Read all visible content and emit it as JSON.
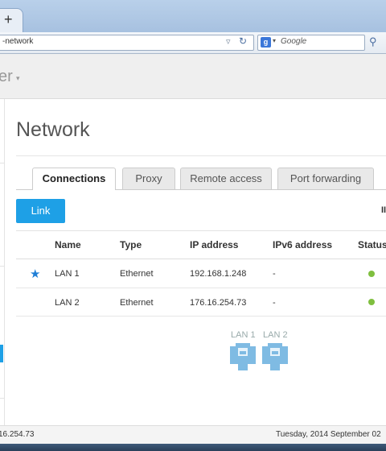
{
  "browser": {
    "new_tab": "+",
    "url_fragment": "-network",
    "search_placeholder": "Google"
  },
  "app": {
    "title_fragment": "er",
    "title_caret": "▾"
  },
  "page": {
    "title": "Network",
    "tabs": [
      {
        "label": "Connections",
        "active": true
      },
      {
        "label": "Proxy",
        "active": false
      },
      {
        "label": "Remote access",
        "active": false
      },
      {
        "label": "Port forwarding",
        "active": false
      }
    ],
    "link_button": "Link",
    "toolbar_fragment": "II"
  },
  "table": {
    "headers": [
      "Name",
      "Type",
      "IP address",
      "IPv6 address",
      "Status"
    ],
    "rows": [
      {
        "starred": true,
        "name": "LAN 1",
        "type": "Ethernet",
        "ip": "192.168.1.248",
        "ipv6": "-",
        "status": "ok"
      },
      {
        "starred": false,
        "name": "LAN 2",
        "type": "Ethernet",
        "ip": "176.16.254.73",
        "ipv6": "-",
        "status": "ok"
      }
    ]
  },
  "ports": [
    "LAN 1",
    "LAN 2"
  ],
  "statusbar": {
    "ip_fragment": "16.254.73",
    "date": "Tuesday, 2014 September 02"
  },
  "colors": {
    "accent": "#1ea0e6",
    "status_ok": "#7fbf3f",
    "port": "#7fbbe3"
  }
}
